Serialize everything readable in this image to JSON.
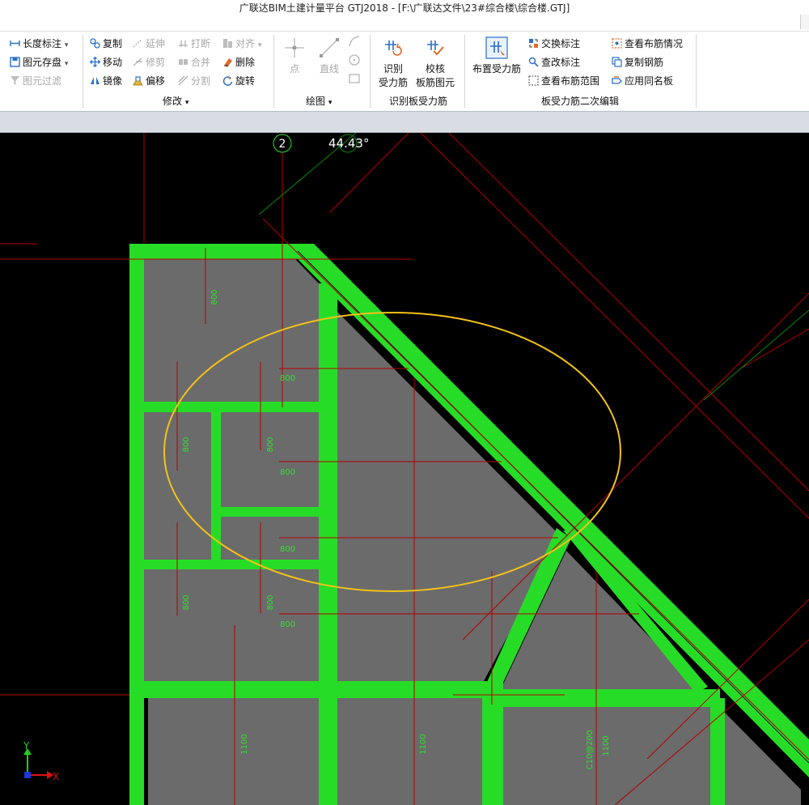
{
  "app": {
    "title": "广联达BIM土建计量平台 GTJ2018 - [F:\\广联达文件\\23#综合楼\\综合楼.GTJ]"
  },
  "ribbon": {
    "col_a": [
      {
        "label": "长度标注",
        "icon": "ruler-icon",
        "arrow": "▾"
      },
      {
        "label": "图元存盘",
        "icon": "save-element-icon",
        "arrow": "▾"
      },
      {
        "label": "图元过滤",
        "icon": "filter-icon",
        "disabled": true
      }
    ],
    "modify": {
      "copy": "复制",
      "move": "移动",
      "mirror": "镜像",
      "extend": "延伸",
      "trim": "修剪",
      "offset": "偏移",
      "break": "打断",
      "merge": "合并",
      "split": "分割",
      "align": "对齐",
      "delete": "删除",
      "rotate": "旋转",
      "group_label": "修改",
      "group_arrow": "▾"
    },
    "draw": {
      "point": "点",
      "line": "直线",
      "group_label": "绘图",
      "group_arrow": "▾"
    },
    "identify": {
      "identify_btn": [
        "识别",
        "受力筋"
      ],
      "check_btn": [
        "校核",
        "板筋图元"
      ],
      "group_label": "识别板受力筋"
    },
    "edit2": {
      "place_btn": "布置受力筋",
      "swap_label": "交换标注",
      "modify_label": "查改标注",
      "view_range": "查看布筋范围",
      "view_layout": "查看布筋情况",
      "copy_rebar": "复制钢筋",
      "apply_same": "应用同名板",
      "group_label": "板受力筋二次编辑"
    }
  },
  "canvas": {
    "axis_number": "2",
    "angle_readout": "44.43°",
    "dims": {
      "top": "800",
      "h1": "800",
      "h2": "800",
      "h3": "800",
      "h4": "800",
      "v1": "800",
      "v2": "800",
      "v3": "800",
      "v4": "800",
      "b1": "1100",
      "b2": "1100",
      "b3": "1100",
      "b_code": "C10@200"
    },
    "ucs": {
      "y": "Y",
      "x": "X"
    }
  },
  "colors": {
    "beam_green": "#27dc27",
    "slab_gray": "#6b6b6b",
    "rebar_red": "#b40000",
    "highlight_yellow": "#f3c218",
    "axis_green": "#0a8a0a"
  }
}
